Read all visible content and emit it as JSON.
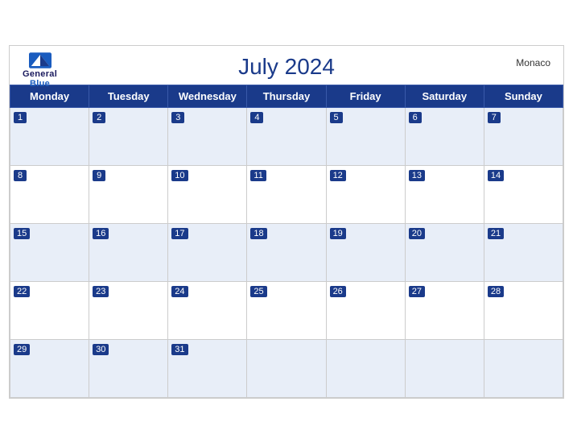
{
  "header": {
    "title": "July 2024",
    "country": "Monaco",
    "logo": {
      "general": "General",
      "blue": "Blue"
    }
  },
  "weekdays": [
    "Monday",
    "Tuesday",
    "Wednesday",
    "Thursday",
    "Friday",
    "Saturday",
    "Sunday"
  ],
  "weeks": [
    [
      {
        "day": 1,
        "empty": false
      },
      {
        "day": 2,
        "empty": false
      },
      {
        "day": 3,
        "empty": false
      },
      {
        "day": 4,
        "empty": false
      },
      {
        "day": 5,
        "empty": false
      },
      {
        "day": 6,
        "empty": false
      },
      {
        "day": 7,
        "empty": false
      }
    ],
    [
      {
        "day": 8,
        "empty": false
      },
      {
        "day": 9,
        "empty": false
      },
      {
        "day": 10,
        "empty": false
      },
      {
        "day": 11,
        "empty": false
      },
      {
        "day": 12,
        "empty": false
      },
      {
        "day": 13,
        "empty": false
      },
      {
        "day": 14,
        "empty": false
      }
    ],
    [
      {
        "day": 15,
        "empty": false
      },
      {
        "day": 16,
        "empty": false
      },
      {
        "day": 17,
        "empty": false
      },
      {
        "day": 18,
        "empty": false
      },
      {
        "day": 19,
        "empty": false
      },
      {
        "day": 20,
        "empty": false
      },
      {
        "day": 21,
        "empty": false
      }
    ],
    [
      {
        "day": 22,
        "empty": false
      },
      {
        "day": 23,
        "empty": false
      },
      {
        "day": 24,
        "empty": false
      },
      {
        "day": 25,
        "empty": false
      },
      {
        "day": 26,
        "empty": false
      },
      {
        "day": 27,
        "empty": false
      },
      {
        "day": 28,
        "empty": false
      }
    ],
    [
      {
        "day": 29,
        "empty": false
      },
      {
        "day": 30,
        "empty": false
      },
      {
        "day": 31,
        "empty": false
      },
      {
        "day": null,
        "empty": true
      },
      {
        "day": null,
        "empty": true
      },
      {
        "day": null,
        "empty": true
      },
      {
        "day": null,
        "empty": true
      }
    ]
  ]
}
